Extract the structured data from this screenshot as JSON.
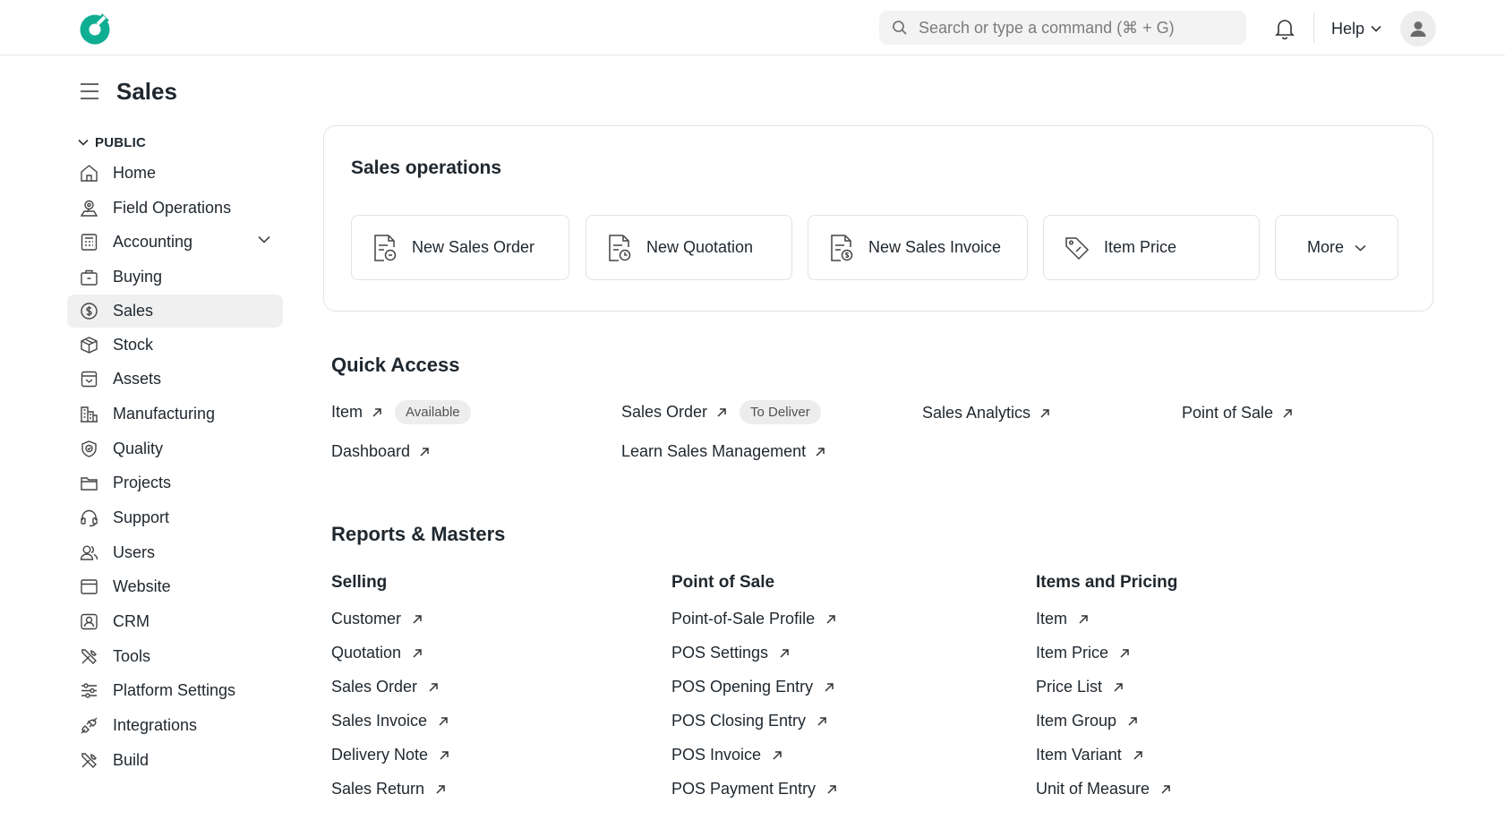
{
  "app": {
    "brand_color": "#0fae92"
  },
  "topbar": {
    "search_placeholder": "Search or type a command (⌘ + G)",
    "help_label": "Help",
    "icons": [
      "search-icon",
      "bell-icon",
      "chevron-down-icon",
      "user-icon"
    ]
  },
  "page": {
    "title": "Sales"
  },
  "sidebar": {
    "section_label": "PUBLIC",
    "active_item": "Sales",
    "items": [
      {
        "label": "Home",
        "icon": "home-icon"
      },
      {
        "label": "Field Operations",
        "icon": "field-operations-icon"
      },
      {
        "label": "Accounting",
        "icon": "accounting-icon"
      },
      {
        "label": "Buying",
        "icon": "buying-icon"
      },
      {
        "label": "Sales",
        "icon": "sales-icon"
      },
      {
        "label": "Stock",
        "icon": "stock-icon"
      },
      {
        "label": "Assets",
        "icon": "assets-icon"
      },
      {
        "label": "Manufacturing",
        "icon": "manufacturing-icon"
      },
      {
        "label": "Quality",
        "icon": "quality-icon"
      },
      {
        "label": "Projects",
        "icon": "projects-icon"
      },
      {
        "label": "Support",
        "icon": "support-icon"
      },
      {
        "label": "Users",
        "icon": "users-icon"
      },
      {
        "label": "Website",
        "icon": "website-icon"
      },
      {
        "label": "CRM",
        "icon": "crm-icon"
      },
      {
        "label": "Tools",
        "icon": "tools-icon"
      },
      {
        "label": "Platform Settings",
        "icon": "platform-settings-icon"
      },
      {
        "label": "Integrations",
        "icon": "integrations-icon"
      },
      {
        "label": "Build",
        "icon": "build-icon"
      }
    ]
  },
  "operations": {
    "title": "Sales operations",
    "buttons": [
      {
        "label": "New Sales Order",
        "icon": "sales-order-doc-icon"
      },
      {
        "label": "New Quotation",
        "icon": "quotation-doc-icon"
      },
      {
        "label": "New Sales Invoice",
        "icon": "invoice-doc-icon"
      },
      {
        "label": "Item Price",
        "icon": "price-tag-icon"
      }
    ],
    "more_label": "More"
  },
  "quick_access": {
    "title": "Quick Access",
    "links": [
      {
        "label": "Item",
        "badge": "Available"
      },
      {
        "label": "Sales Order",
        "badge": "To Deliver"
      },
      {
        "label": "Sales Analytics"
      },
      {
        "label": "Point of Sale"
      },
      {
        "label": "Dashboard"
      },
      {
        "label": "Learn Sales Management"
      }
    ]
  },
  "reports": {
    "title": "Reports & Masters",
    "columns": [
      {
        "title": "Selling",
        "links": [
          "Customer",
          "Quotation",
          "Sales Order",
          "Sales Invoice",
          "Delivery Note",
          "Sales Return"
        ]
      },
      {
        "title": "Point of Sale",
        "links": [
          "Point-of-Sale Profile",
          "POS Settings",
          "POS Opening Entry",
          "POS Closing Entry",
          "POS Invoice",
          "POS Payment Entry"
        ]
      },
      {
        "title": "Items and Pricing",
        "links": [
          "Item",
          "Item Price",
          "Price List",
          "Item Group",
          "Item Variant",
          "Unit of Measure"
        ]
      }
    ]
  }
}
